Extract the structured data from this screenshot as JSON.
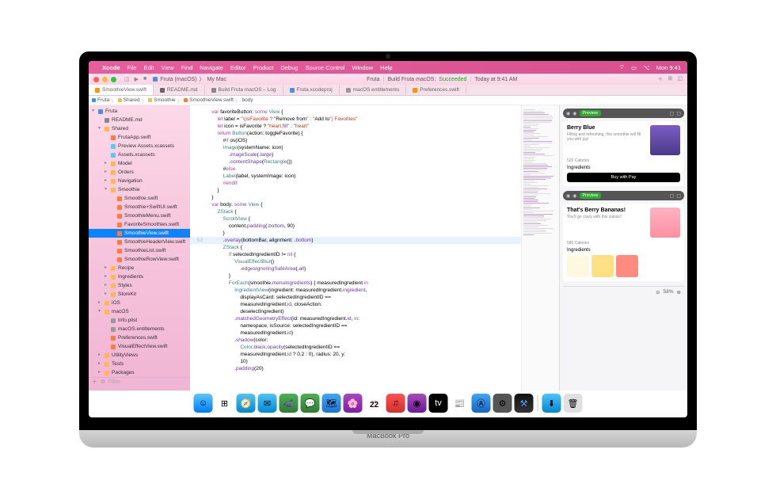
{
  "menubar": {
    "app": "Xcode",
    "items": [
      "File",
      "Edit",
      "View",
      "Find",
      "Navigate",
      "Editor",
      "Product",
      "Debug",
      "Source Control",
      "Window",
      "Help"
    ],
    "clock": "Mon 9:41"
  },
  "titlebar": {
    "scheme": "Fruta (macOS)",
    "device": "My Mac",
    "status_project": "Fruta",
    "status_action": "Build Fruta macOS:",
    "status_result": "Succeeded",
    "status_time": "Today at 9:41 AM"
  },
  "tabs": [
    {
      "label": "SmoothieView.swift",
      "icon": "swift",
      "active": true
    },
    {
      "label": "README.md",
      "icon": "md"
    },
    {
      "label": "Build Fruta macOS – Log",
      "icon": "log"
    },
    {
      "label": "Fruta.xcodeproj",
      "icon": "proj"
    },
    {
      "label": "macOS.entitlements",
      "icon": "ent"
    },
    {
      "label": "Preferences.swift",
      "icon": "swift"
    }
  ],
  "breadcrumb": [
    "Fruta",
    "Shared",
    "Smoothie",
    "SmoothieView.swift",
    "body"
  ],
  "sidebar": {
    "project": "Fruta",
    "items": [
      {
        "label": "README.md",
        "icon": "md",
        "i": 1,
        "tri": ""
      },
      {
        "label": "Shared",
        "icon": "folder",
        "i": 1,
        "tri": "▾"
      },
      {
        "label": "FrutaApp.swift",
        "icon": "swift",
        "i": 2,
        "tri": ""
      },
      {
        "label": "Preview Assets.xcassets",
        "icon": "asset",
        "i": 2,
        "tri": ""
      },
      {
        "label": "Assets.xcassets",
        "icon": "asset",
        "i": 2,
        "tri": ""
      },
      {
        "label": "Model",
        "icon": "folder",
        "i": 2,
        "tri": "▸"
      },
      {
        "label": "Orders",
        "icon": "folder",
        "i": 2,
        "tri": "▸"
      },
      {
        "label": "Navigation",
        "icon": "folder",
        "i": 2,
        "tri": "▸"
      },
      {
        "label": "Smoothie",
        "icon": "folder",
        "i": 2,
        "tri": "▾"
      },
      {
        "label": "Smoothie.swift",
        "icon": "swift",
        "i": 3,
        "tri": ""
      },
      {
        "label": "Smoothie+SwiftUI.swift",
        "icon": "swift",
        "i": 3,
        "tri": ""
      },
      {
        "label": "SmoothieMenu.swift",
        "icon": "swift",
        "i": 3,
        "tri": ""
      },
      {
        "label": "FavoriteSmoothies.swift",
        "icon": "swift",
        "i": 3,
        "tri": ""
      },
      {
        "label": "SmoothieView.swift",
        "icon": "swift",
        "i": 3,
        "tri": "",
        "sel": true
      },
      {
        "label": "SmoothieHeaderView.swift",
        "icon": "swift",
        "i": 3,
        "tri": ""
      },
      {
        "label": "SmoothieList.swift",
        "icon": "swift",
        "i": 3,
        "tri": ""
      },
      {
        "label": "SmoothieRowView.swift",
        "icon": "swift",
        "i": 3,
        "tri": ""
      },
      {
        "label": "Recipe",
        "icon": "folder",
        "i": 2,
        "tri": "▸"
      },
      {
        "label": "Ingredients",
        "icon": "folder",
        "i": 2,
        "tri": "▸"
      },
      {
        "label": "Styles",
        "icon": "folder",
        "i": 2,
        "tri": "▸"
      },
      {
        "label": "StoreKit",
        "icon": "folder",
        "i": 2,
        "tri": "▸"
      },
      {
        "label": "iOS",
        "icon": "folder",
        "i": 1,
        "tri": "▸"
      },
      {
        "label": "macOS",
        "icon": "folder",
        "i": 1,
        "tri": "▾"
      },
      {
        "label": "Info.plist",
        "icon": "plist",
        "i": 2,
        "tri": ""
      },
      {
        "label": "macOS.entitlements",
        "icon": "plist",
        "i": 2,
        "tri": ""
      },
      {
        "label": "Preferences.swift",
        "icon": "swift",
        "i": 2,
        "tri": ""
      },
      {
        "label": "VisualEffectView.swift",
        "icon": "swift",
        "i": 2,
        "tri": ""
      },
      {
        "label": "UtilityViews",
        "icon": "folder",
        "i": 1,
        "tri": "▸"
      },
      {
        "label": "Tests",
        "icon": "folder",
        "i": 1,
        "tri": "▸"
      },
      {
        "label": "Packages",
        "icon": "folder",
        "i": 1,
        "tri": "▸"
      }
    ],
    "filter_placeholder": "Filter"
  },
  "code": [
    {
      "n": "",
      "t": "    var favoriteButton: some View {",
      "cls": [
        "kw",
        "",
        "ty",
        ""
      ]
    },
    {
      "n": "",
      "t": "        let label = \"\\(isFavorite ? \"Remove from\" : \"Add to\") Favorites\""
    },
    {
      "n": "",
      "t": "        let icon = isFavorite ? \"heart.fill\" : \"heart\""
    },
    {
      "n": "",
      "t": "        return Button(action: toggleFavorite) {"
    },
    {
      "n": "",
      "t": "            #if os(iOS)"
    },
    {
      "n": "",
      "t": "            Image(systemName: icon)"
    },
    {
      "n": "",
      "t": "                .imageScale(.large)"
    },
    {
      "n": "",
      "t": "                .contentShape(Rectangle())"
    },
    {
      "n": "",
      "t": "            #else"
    },
    {
      "n": "",
      "t": "            Label(label, systemImage: icon)"
    },
    {
      "n": "",
      "t": "            #endif"
    },
    {
      "n": "",
      "t": "        }"
    },
    {
      "n": "",
      "t": "    }"
    },
    {
      "n": "",
      "t": ""
    },
    {
      "n": "",
      "t": "    var body: some View {"
    },
    {
      "n": "",
      "t": "        ZStack {"
    },
    {
      "n": "",
      "t": "            ScrollView {"
    },
    {
      "n": "",
      "t": "                content.padding(.bottom, 90)"
    },
    {
      "n": "",
      "t": "            }"
    },
    {
      "n": "53",
      "t": "            .overlay(bottomBar, alignment: .bottom)",
      "hl": true
    },
    {
      "n": "",
      "t": ""
    },
    {
      "n": "",
      "t": "            ZStack {"
    },
    {
      "n": "",
      "t": "                if selectedIngredientID != nil {"
    },
    {
      "n": "",
      "t": "                    VisualEffectBlur()"
    },
    {
      "n": "",
      "t": "                        .edgesIgnoringSafeArea(.all)"
    },
    {
      "n": "",
      "t": "                }"
    },
    {
      "n": "",
      "t": ""
    },
    {
      "n": "",
      "t": "                ForEach(smoothie.menuIngredients) { measuredIngredient in"
    },
    {
      "n": "",
      "t": "                    IngredientView(ingredient: measuredIngredient.ingredient,"
    },
    {
      "n": "",
      "t": "                        displayAsCard: selectedIngredientID =="
    },
    {
      "n": "",
      "t": "                        measuredIngredient.id, closeAction:"
    },
    {
      "n": "",
      "t": "                        deselectIngredient)"
    },
    {
      "n": "",
      "t": "                    .matchedGeometryEffect(id: measuredIngredient.id, in:"
    },
    {
      "n": "",
      "t": "                        namespace, isSource: selectedIngredientID =="
    },
    {
      "n": "",
      "t": "                        measuredIngredient.id)"
    },
    {
      "n": "",
      "t": "                    .shadow(color:"
    },
    {
      "n": "",
      "t": "                        Color.black.opacity(selectedIngredientID =="
    },
    {
      "n": "",
      "t": "                        measuredIngredient.id ? 0.2 : 0), radius: 20, y:"
    },
    {
      "n": "",
      "t": "                        10)"
    },
    {
      "n": "",
      "t": "                    .padding(20)"
    }
  ],
  "preview": {
    "btn": "Preview",
    "card1": {
      "title": "Berry Blue",
      "sub": "Filling and refreshing, this smoothie will fill you with joy!",
      "cal": "520 Calories",
      "sec": "Ingredients",
      "pay": "Buy with  Pay"
    },
    "card2": {
      "title": "That's Berry Bananas!",
      "sub": "You'll go crazy with this classic!",
      "cal": "580 Calories",
      "sec": "Ingredients"
    },
    "zoom": "58%"
  },
  "base_label": "MacBook Pro",
  "dock_date": {
    "month": "JUN",
    "day": "22"
  }
}
